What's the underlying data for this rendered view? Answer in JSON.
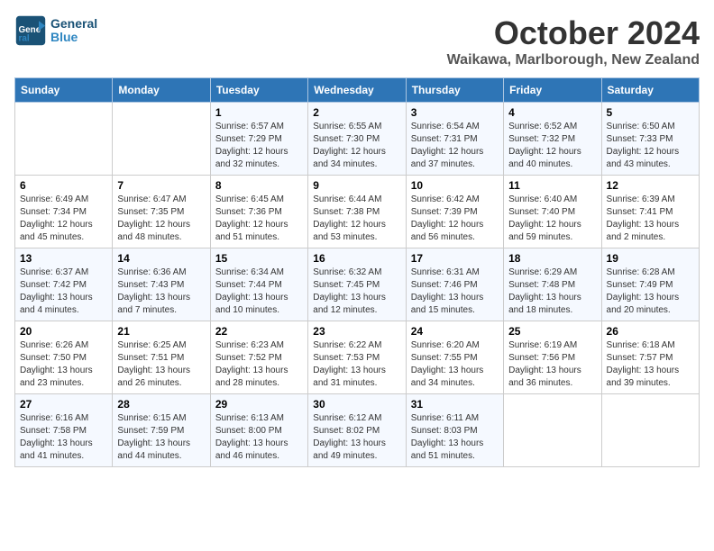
{
  "header": {
    "logo_text_general": "General",
    "logo_text_blue": "Blue",
    "month_title": "October 2024",
    "location": "Waikawa, Marlborough, New Zealand"
  },
  "weekdays": [
    "Sunday",
    "Monday",
    "Tuesday",
    "Wednesday",
    "Thursday",
    "Friday",
    "Saturday"
  ],
  "weeks": [
    [
      {
        "day": "",
        "sunrise": "",
        "sunset": "",
        "daylight": ""
      },
      {
        "day": "",
        "sunrise": "",
        "sunset": "",
        "daylight": ""
      },
      {
        "day": "1",
        "sunrise": "Sunrise: 6:57 AM",
        "sunset": "Sunset: 7:29 PM",
        "daylight": "Daylight: 12 hours and 32 minutes."
      },
      {
        "day": "2",
        "sunrise": "Sunrise: 6:55 AM",
        "sunset": "Sunset: 7:30 PM",
        "daylight": "Daylight: 12 hours and 34 minutes."
      },
      {
        "day": "3",
        "sunrise": "Sunrise: 6:54 AM",
        "sunset": "Sunset: 7:31 PM",
        "daylight": "Daylight: 12 hours and 37 minutes."
      },
      {
        "day": "4",
        "sunrise": "Sunrise: 6:52 AM",
        "sunset": "Sunset: 7:32 PM",
        "daylight": "Daylight: 12 hours and 40 minutes."
      },
      {
        "day": "5",
        "sunrise": "Sunrise: 6:50 AM",
        "sunset": "Sunset: 7:33 PM",
        "daylight": "Daylight: 12 hours and 43 minutes."
      }
    ],
    [
      {
        "day": "6",
        "sunrise": "Sunrise: 6:49 AM",
        "sunset": "Sunset: 7:34 PM",
        "daylight": "Daylight: 12 hours and 45 minutes."
      },
      {
        "day": "7",
        "sunrise": "Sunrise: 6:47 AM",
        "sunset": "Sunset: 7:35 PM",
        "daylight": "Daylight: 12 hours and 48 minutes."
      },
      {
        "day": "8",
        "sunrise": "Sunrise: 6:45 AM",
        "sunset": "Sunset: 7:36 PM",
        "daylight": "Daylight: 12 hours and 51 minutes."
      },
      {
        "day": "9",
        "sunrise": "Sunrise: 6:44 AM",
        "sunset": "Sunset: 7:38 PM",
        "daylight": "Daylight: 12 hours and 53 minutes."
      },
      {
        "day": "10",
        "sunrise": "Sunrise: 6:42 AM",
        "sunset": "Sunset: 7:39 PM",
        "daylight": "Daylight: 12 hours and 56 minutes."
      },
      {
        "day": "11",
        "sunrise": "Sunrise: 6:40 AM",
        "sunset": "Sunset: 7:40 PM",
        "daylight": "Daylight: 12 hours and 59 minutes."
      },
      {
        "day": "12",
        "sunrise": "Sunrise: 6:39 AM",
        "sunset": "Sunset: 7:41 PM",
        "daylight": "Daylight: 13 hours and 2 minutes."
      }
    ],
    [
      {
        "day": "13",
        "sunrise": "Sunrise: 6:37 AM",
        "sunset": "Sunset: 7:42 PM",
        "daylight": "Daylight: 13 hours and 4 minutes."
      },
      {
        "day": "14",
        "sunrise": "Sunrise: 6:36 AM",
        "sunset": "Sunset: 7:43 PM",
        "daylight": "Daylight: 13 hours and 7 minutes."
      },
      {
        "day": "15",
        "sunrise": "Sunrise: 6:34 AM",
        "sunset": "Sunset: 7:44 PM",
        "daylight": "Daylight: 13 hours and 10 minutes."
      },
      {
        "day": "16",
        "sunrise": "Sunrise: 6:32 AM",
        "sunset": "Sunset: 7:45 PM",
        "daylight": "Daylight: 13 hours and 12 minutes."
      },
      {
        "day": "17",
        "sunrise": "Sunrise: 6:31 AM",
        "sunset": "Sunset: 7:46 PM",
        "daylight": "Daylight: 13 hours and 15 minutes."
      },
      {
        "day": "18",
        "sunrise": "Sunrise: 6:29 AM",
        "sunset": "Sunset: 7:48 PM",
        "daylight": "Daylight: 13 hours and 18 minutes."
      },
      {
        "day": "19",
        "sunrise": "Sunrise: 6:28 AM",
        "sunset": "Sunset: 7:49 PM",
        "daylight": "Daylight: 13 hours and 20 minutes."
      }
    ],
    [
      {
        "day": "20",
        "sunrise": "Sunrise: 6:26 AM",
        "sunset": "Sunset: 7:50 PM",
        "daylight": "Daylight: 13 hours and 23 minutes."
      },
      {
        "day": "21",
        "sunrise": "Sunrise: 6:25 AM",
        "sunset": "Sunset: 7:51 PM",
        "daylight": "Daylight: 13 hours and 26 minutes."
      },
      {
        "day": "22",
        "sunrise": "Sunrise: 6:23 AM",
        "sunset": "Sunset: 7:52 PM",
        "daylight": "Daylight: 13 hours and 28 minutes."
      },
      {
        "day": "23",
        "sunrise": "Sunrise: 6:22 AM",
        "sunset": "Sunset: 7:53 PM",
        "daylight": "Daylight: 13 hours and 31 minutes."
      },
      {
        "day": "24",
        "sunrise": "Sunrise: 6:20 AM",
        "sunset": "Sunset: 7:55 PM",
        "daylight": "Daylight: 13 hours and 34 minutes."
      },
      {
        "day": "25",
        "sunrise": "Sunrise: 6:19 AM",
        "sunset": "Sunset: 7:56 PM",
        "daylight": "Daylight: 13 hours and 36 minutes."
      },
      {
        "day": "26",
        "sunrise": "Sunrise: 6:18 AM",
        "sunset": "Sunset: 7:57 PM",
        "daylight": "Daylight: 13 hours and 39 minutes."
      }
    ],
    [
      {
        "day": "27",
        "sunrise": "Sunrise: 6:16 AM",
        "sunset": "Sunset: 7:58 PM",
        "daylight": "Daylight: 13 hours and 41 minutes."
      },
      {
        "day": "28",
        "sunrise": "Sunrise: 6:15 AM",
        "sunset": "Sunset: 7:59 PM",
        "daylight": "Daylight: 13 hours and 44 minutes."
      },
      {
        "day": "29",
        "sunrise": "Sunrise: 6:13 AM",
        "sunset": "Sunset: 8:00 PM",
        "daylight": "Daylight: 13 hours and 46 minutes."
      },
      {
        "day": "30",
        "sunrise": "Sunrise: 6:12 AM",
        "sunset": "Sunset: 8:02 PM",
        "daylight": "Daylight: 13 hours and 49 minutes."
      },
      {
        "day": "31",
        "sunrise": "Sunrise: 6:11 AM",
        "sunset": "Sunset: 8:03 PM",
        "daylight": "Daylight: 13 hours and 51 minutes."
      },
      {
        "day": "",
        "sunrise": "",
        "sunset": "",
        "daylight": ""
      },
      {
        "day": "",
        "sunrise": "",
        "sunset": "",
        "daylight": ""
      }
    ]
  ]
}
